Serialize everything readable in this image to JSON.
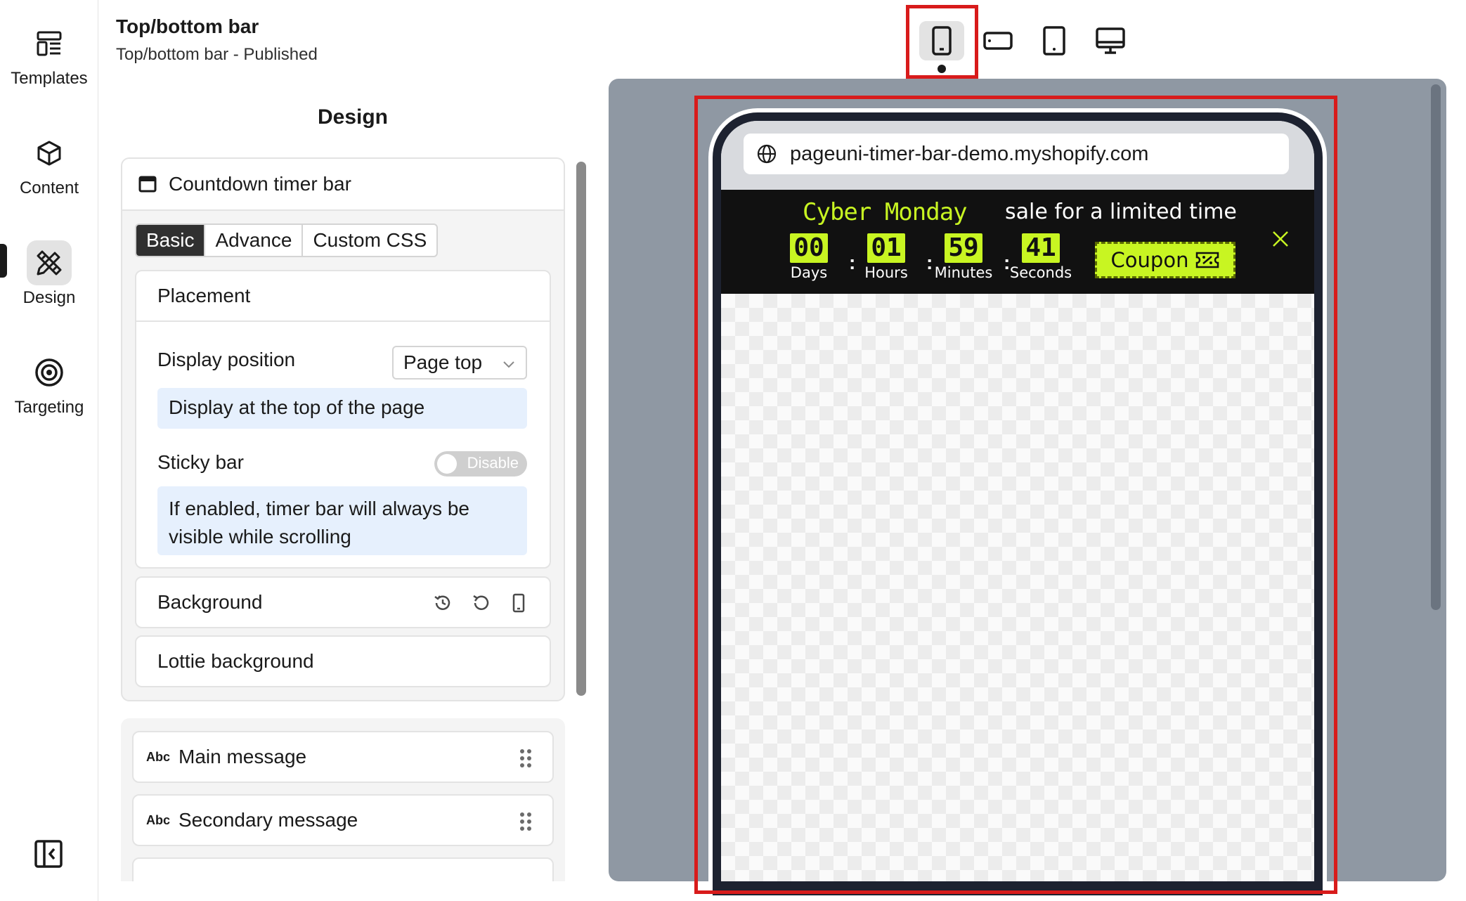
{
  "rail": {
    "items": [
      {
        "label": "Templates",
        "icon": "templates-icon"
      },
      {
        "label": "Content",
        "icon": "cube-icon"
      },
      {
        "label": "Design",
        "icon": "design-tools-icon",
        "active": true
      },
      {
        "label": "Targeting",
        "icon": "target-icon"
      }
    ],
    "collapse_icon": "collapse-sidebar-icon"
  },
  "header": {
    "title": "Top/bottom bar",
    "subtitle": "Top/bottom bar - Published"
  },
  "design": {
    "title": "Design",
    "section_title": "Countdown timer bar",
    "tabs": [
      "Basic",
      "Advance",
      "Custom CSS"
    ],
    "active_tab": "Basic",
    "placement": {
      "title": "Placement",
      "display_position_label": "Display position",
      "display_position_value": "Page top",
      "display_position_help": "Display at the top of the page",
      "sticky_label": "Sticky bar",
      "sticky_state": "Disable",
      "sticky_help": "If enabled, timer bar will always be visible while scrolling"
    },
    "background_label": "Background",
    "lottie_label": "Lottie background",
    "elements": [
      {
        "badge": "Abc",
        "label": "Main message"
      },
      {
        "badge": "Abc",
        "label": "Secondary message"
      }
    ]
  },
  "devices": {
    "options": [
      "mobile",
      "mobile-landscape",
      "tablet",
      "desktop"
    ],
    "active": "mobile"
  },
  "preview": {
    "url": "pageuni-timer-bar-demo.myshopify.com",
    "main_message": "Cyber Monday",
    "secondary_message": "sale for a limited time",
    "timer": [
      {
        "value": "00",
        "label": "Days"
      },
      {
        "value": "01",
        "label": "Hours"
      },
      {
        "value": "59",
        "label": "Minutes"
      },
      {
        "value": "41",
        "label": "Seconds"
      }
    ],
    "separator": ":",
    "coupon_label": "Coupon",
    "colors": {
      "accent": "#c8f522",
      "bar_bg": "#111111",
      "highlight": "#d81b1b"
    }
  }
}
